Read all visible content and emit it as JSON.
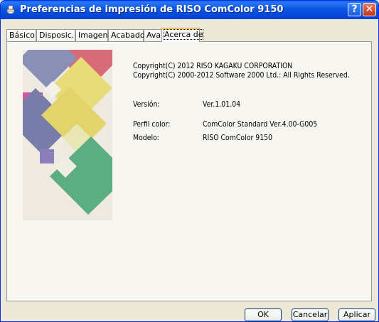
{
  "window": {
    "title": "Preferencias de impresión de RISO ComColor 9150",
    "help_label": "?",
    "close_label": "✕"
  },
  "tabs": [
    {
      "label": "Básico"
    },
    {
      "label": "Disposic."
    },
    {
      "label": "Imagen"
    },
    {
      "label": "Acabado"
    },
    {
      "label": "Avanzado"
    },
    {
      "label": "Acerca de",
      "active": true
    }
  ],
  "about": {
    "copyright1": "Copyright(C) 2012   RISO KAGAKU CORPORATION",
    "copyright2": "Copyright(C) 2000-2012   Software 2000 Ltd.: All Rights Reserved.",
    "version_label": "Versión:",
    "version_value": "Ver.1.01.04",
    "profile_label": "Perfil color:",
    "profile_value": "ComColor Standard Ver.4.00-G005",
    "model_label": "Modelo:",
    "model_value": "RISO ComColor 9150"
  },
  "buttons": {
    "ok": "OK",
    "cancel": "Cancelar",
    "apply": "Aplicar"
  }
}
